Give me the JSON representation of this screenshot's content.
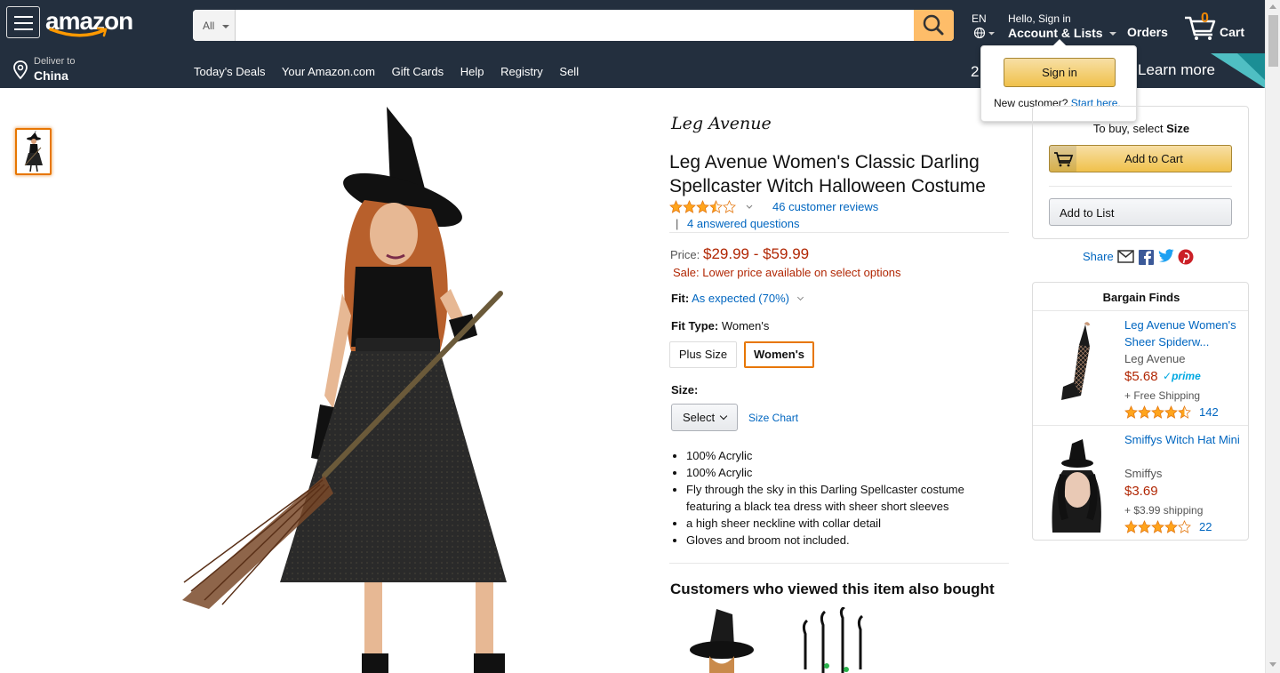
{
  "nav": {
    "logo": "amazon",
    "search_category": "All",
    "search_placeholder": "",
    "lang": "EN",
    "hello": "Hello, Sign in",
    "account": "Account & Lists",
    "orders": "Orders",
    "cart_count": "0",
    "cart_label": "Cart",
    "deliver_label": "Deliver to",
    "deliver_country": "China",
    "links": [
      "Today's Deals",
      "Your Amazon.com",
      "Gift Cards",
      "Help",
      "Registry",
      "Sell"
    ],
    "promo_left": "2",
    "promo_right": "Learn more"
  },
  "flyout": {
    "signin": "Sign in",
    "new_customer": "New customer?",
    "start_here": "Start here."
  },
  "product": {
    "brand": "Leg Avenue",
    "title": "Leg Avenue Women's Classic Darling Spellcaster Witch Halloween Costume",
    "rating": 3.5,
    "reviews": "46 customer reviews",
    "answered_sep": "|",
    "answered": "4 answered questions",
    "price_label": "Price:",
    "price": "$29.99 - $59.99",
    "sale": "Sale:  Lower price available on select options",
    "fit_label": "Fit:",
    "fit_value": "As expected (70%)",
    "fit_type_label": "Fit Type:",
    "fit_type_value": "Women's",
    "fit_options": [
      "Plus Size",
      "Women's"
    ],
    "size_label": "Size:",
    "size_select": "Select",
    "size_chart": "Size Chart",
    "bullets": [
      "100% Acrylic",
      "100% Acrylic",
      "Fly through the sky in this Darling Spellcaster costume featuring a black tea dress with sheer short sleeves",
      "a high sheer neckline with collar detail",
      "Gloves and broom not included."
    ],
    "also_bought_title": "Customers who viewed this item also bought"
  },
  "buybox": {
    "to_buy_prefix": "To buy, select",
    "to_buy_bold": "Size",
    "add_to_cart": "Add to Cart",
    "add_to_list": "Add to List",
    "share": "Share"
  },
  "bargain": {
    "title": "Bargain Finds",
    "items": [
      {
        "name": "Leg Avenue Women's Sheer Spiderw...",
        "by": "Leg Avenue",
        "price": "$5.68",
        "prime": "prime",
        "shipping": "+ Free Shipping",
        "rating": 4.5,
        "count": "142"
      },
      {
        "name": "Smiffys Witch Hat Mini",
        "by": "Smiffys",
        "price": "$3.69",
        "shipping": "+ $3.99 shipping",
        "rating": 4,
        "count": "22"
      }
    ]
  },
  "colors": {
    "nav_bg": "#232f3e",
    "price": "#b12704",
    "link": "#0066c0",
    "button": "#f0c14b",
    "accent": "#e77600"
  }
}
